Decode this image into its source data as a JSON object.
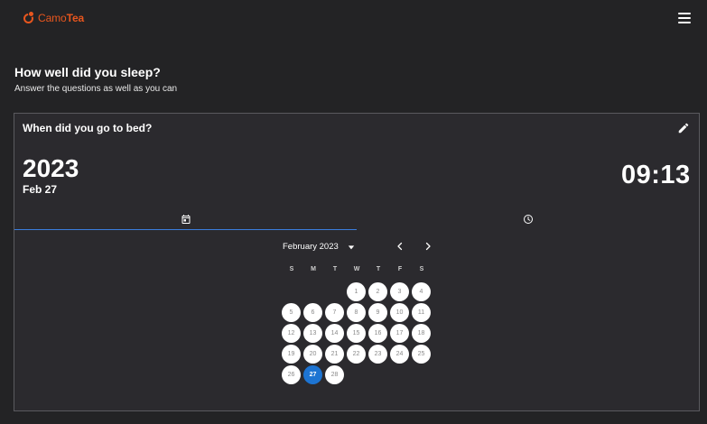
{
  "header": {
    "logo_primary": "Camo",
    "logo_bold": "Tea",
    "brand_color": "#e8561e",
    "menu_icon": "hamburger-menu-icon"
  },
  "page": {
    "title": "How well did you sleep?",
    "subtitle": "Answer the questions as well as you can"
  },
  "question": {
    "title": "When did you go to bed?",
    "edit_icon": "pencil-icon",
    "year": "2023",
    "date": "Feb 27",
    "time": "09:13"
  },
  "tabs": [
    {
      "icon": "calendar-icon",
      "selected": true
    },
    {
      "icon": "clock-icon",
      "selected": false
    }
  ],
  "calendar": {
    "month_label": "February 2023",
    "weekdays": [
      "S",
      "M",
      "T",
      "W",
      "T",
      "F",
      "S"
    ],
    "first_weekday": 3,
    "days": [
      "1",
      "2",
      "3",
      "4",
      "5",
      "6",
      "7",
      "8",
      "9",
      "10",
      "11",
      "12",
      "13",
      "14",
      "15",
      "16",
      "17",
      "18",
      "19",
      "20",
      "21",
      "22",
      "23",
      "24",
      "25",
      "26",
      "27",
      "28"
    ],
    "selected_day": "27",
    "accent_color": "#1d74d2"
  }
}
